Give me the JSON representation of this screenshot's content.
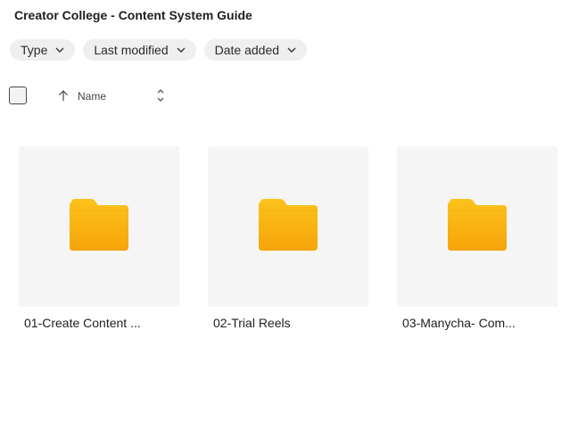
{
  "header": {
    "title": "Creator College - Content System Guide"
  },
  "filters": [
    {
      "label": "Type"
    },
    {
      "label": "Last modified"
    },
    {
      "label": "Date added"
    }
  ],
  "sort": {
    "label": "Name",
    "direction": "ascending"
  },
  "folders": [
    {
      "name": "01-Create Content ..."
    },
    {
      "name": "02-Trial Reels"
    },
    {
      "name": "03-Manycha- Com..."
    }
  ],
  "colors": {
    "folder_top": "#fcc21b",
    "folder_bottom": "#f5a40a",
    "tile_bg": "#f5f5f5",
    "chip_bg": "#efefef"
  }
}
